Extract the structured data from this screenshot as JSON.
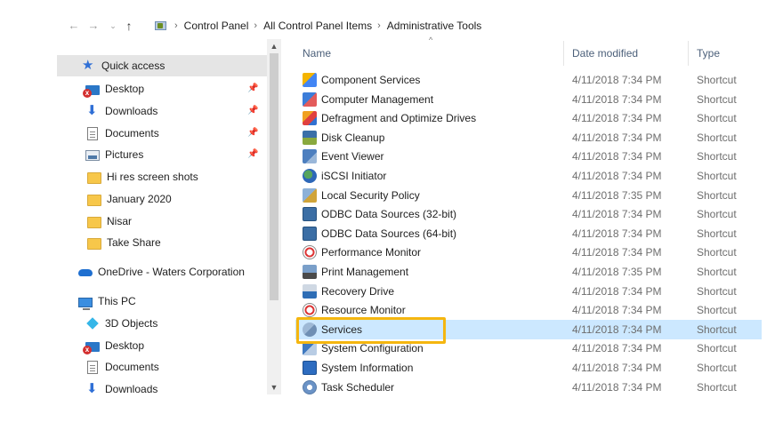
{
  "address_bar": {
    "back_icon": "arrow-left-icon",
    "forward_icon": "arrow-right-icon",
    "recent_icon": "chevron-down-icon",
    "up_icon": "arrow-up-icon",
    "glyphs": {
      "back": "←",
      "forward": "→",
      "recent": "⌄",
      "up": "↑",
      "separator": "›"
    },
    "breadcrumbs": [
      "Control Panel",
      "All Control Panel Items",
      "Administrative Tools"
    ]
  },
  "nav_pane": {
    "quick_access": "Quick access",
    "pinned_items": [
      {
        "label": "Desktop",
        "icon": "desktop-icon",
        "pinned": true
      },
      {
        "label": "Downloads",
        "icon": "download-icon",
        "pinned": true
      },
      {
        "label": "Documents",
        "icon": "documents-icon",
        "pinned": true
      },
      {
        "label": "Pictures",
        "icon": "pictures-icon",
        "pinned": true
      }
    ],
    "folders": [
      "Hi res screen shots",
      "January 2020",
      "Nisar",
      "Take Share"
    ],
    "onedrive": "OneDrive - Waters Corporation",
    "this_pc": "This PC",
    "pc_items": [
      {
        "label": "3D Objects",
        "icon": "3d-objects-icon"
      },
      {
        "label": "Desktop",
        "icon": "desktop-icon"
      },
      {
        "label": "Documents",
        "icon": "documents-icon"
      },
      {
        "label": "Downloads",
        "icon": "download-icon"
      }
    ],
    "pin_glyph": "📌"
  },
  "file_list": {
    "columns": {
      "name": "Name",
      "date": "Date modified",
      "type": "Type"
    },
    "sort_glyph": "^",
    "rows": [
      {
        "name": "Component Services",
        "date": "4/11/2018 7:34 PM",
        "type": "Shortcut",
        "icon": "component-services-icon"
      },
      {
        "name": "Computer Management",
        "date": "4/11/2018 7:34 PM",
        "type": "Shortcut",
        "icon": "computer-management-icon"
      },
      {
        "name": "Defragment and Optimize Drives",
        "date": "4/11/2018 7:34 PM",
        "type": "Shortcut",
        "icon": "defragment-icon"
      },
      {
        "name": "Disk Cleanup",
        "date": "4/11/2018 7:34 PM",
        "type": "Shortcut",
        "icon": "disk-cleanup-icon"
      },
      {
        "name": "Event Viewer",
        "date": "4/11/2018 7:34 PM",
        "type": "Shortcut",
        "icon": "event-viewer-icon"
      },
      {
        "name": "iSCSI Initiator",
        "date": "4/11/2018 7:34 PM",
        "type": "Shortcut",
        "icon": "iscsi-initiator-icon"
      },
      {
        "name": "Local Security Policy",
        "date": "4/11/2018 7:35 PM",
        "type": "Shortcut",
        "icon": "local-security-policy-icon"
      },
      {
        "name": "ODBC Data Sources (32-bit)",
        "date": "4/11/2018 7:34 PM",
        "type": "Shortcut",
        "icon": "odbc-icon"
      },
      {
        "name": "ODBC Data Sources (64-bit)",
        "date": "4/11/2018 7:34 PM",
        "type": "Shortcut",
        "icon": "odbc-icon"
      },
      {
        "name": "Performance Monitor",
        "date": "4/11/2018 7:34 PM",
        "type": "Shortcut",
        "icon": "performance-monitor-icon"
      },
      {
        "name": "Print Management",
        "date": "4/11/2018 7:35 PM",
        "type": "Shortcut",
        "icon": "print-management-icon"
      },
      {
        "name": "Recovery Drive",
        "date": "4/11/2018 7:34 PM",
        "type": "Shortcut",
        "icon": "recovery-drive-icon"
      },
      {
        "name": "Resource Monitor",
        "date": "4/11/2018 7:34 PM",
        "type": "Shortcut",
        "icon": "resource-monitor-icon"
      },
      {
        "name": "Services",
        "date": "4/11/2018 7:34 PM",
        "type": "Shortcut",
        "icon": "services-icon",
        "selected": true
      },
      {
        "name": "System Configuration",
        "date": "4/11/2018 7:34 PM",
        "type": "Shortcut",
        "icon": "system-configuration-icon"
      },
      {
        "name": "System Information",
        "date": "4/11/2018 7:34 PM",
        "type": "Shortcut",
        "icon": "system-information-icon"
      },
      {
        "name": "Task Scheduler",
        "date": "4/11/2018 7:34 PM",
        "type": "Shortcut",
        "icon": "task-scheduler-icon"
      }
    ]
  },
  "colors": {
    "selection": "#cce8ff",
    "highlight_border": "#f5b60f",
    "quick_access_bg": "#e5e5e5",
    "header_text": "#4c607a"
  }
}
